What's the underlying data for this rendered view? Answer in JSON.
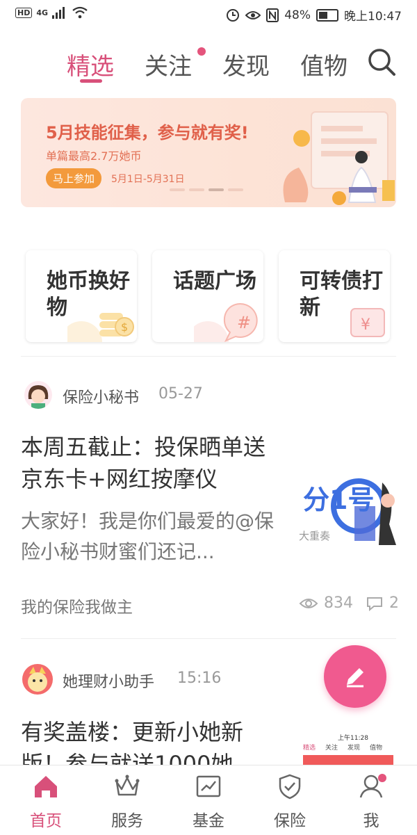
{
  "status": {
    "network": "4G",
    "battery": "48%",
    "time": "晚上10:47"
  },
  "tabs": [
    {
      "label": "精选",
      "active": true
    },
    {
      "label": "关注",
      "has_dot": true
    },
    {
      "label": "发现"
    },
    {
      "label": "值物"
    }
  ],
  "banner": {
    "title": "5月技能征集，参与就有奖!",
    "subtitle": "单篇最高2.7万她币",
    "button": "马上参加",
    "dates": "5月1日-5月31日"
  },
  "cards": [
    {
      "title": "她币换好物"
    },
    {
      "title": "话题广场"
    },
    {
      "title": "可转债打新"
    }
  ],
  "posts": [
    {
      "author": "保险小秘书",
      "time": "05-27",
      "title": "本周五截止：投保晒单送京东卡+网红按摩仪",
      "summary": "大家好！我是你们最爱的@保险小秘书财蜜们还记...",
      "tag": "我的保险我做主",
      "views": "834",
      "comments": "2",
      "thumb_text": "分1号",
      "thumb_sub": "大重奏"
    },
    {
      "author": "她理财小助手",
      "time": "15:16",
      "title": "有奖盖楼：更新小她新版！参与就送1000她",
      "thumb_tabs": [
        "精选",
        "关注",
        "发现",
        "值物"
      ],
      "thumb_time": "上午11:28"
    }
  ],
  "bottom_nav": [
    {
      "label": "首页",
      "icon": "home-icon",
      "active": true
    },
    {
      "label": "服务",
      "icon": "crown-icon"
    },
    {
      "label": "基金",
      "icon": "chart-icon"
    },
    {
      "label": "保险",
      "icon": "shield-icon"
    },
    {
      "label": "我",
      "icon": "user-icon",
      "has_dot": true
    }
  ],
  "colors": {
    "accent": "#d8507a",
    "fab": "#f05a8f"
  }
}
